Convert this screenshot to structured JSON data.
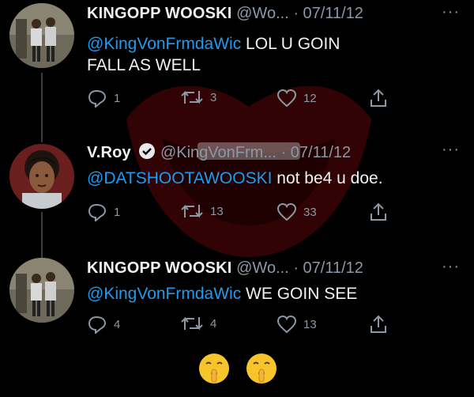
{
  "tweets": [
    {
      "name": "KINGOPP WOOSKI",
      "handle": "@Wo...",
      "separator": "·",
      "date": "07/11/12",
      "more": "···",
      "mention": "@KingVonFrmdaWic",
      "text": " LOL U GOIN FALL AS WELL",
      "replies": "1",
      "retweets": "3",
      "likes": "12"
    },
    {
      "name": "V.Roy",
      "handle": "@KingVonFrm...",
      "separator": "·",
      "date": "07/11/12",
      "more": "···",
      "mention": "@DATSHOOTAWOOSKI",
      "text": " not be4 u doe.",
      "replies": "1",
      "retweets": "13",
      "likes": "33"
    },
    {
      "name": "KINGOPP WOOSKI",
      "handle": "@Wo...",
      "separator": "·",
      "date": "07/11/12",
      "more": "···",
      "mention": "@KingVonFrmdaWic",
      "text": " WE GOIN SEE",
      "replies": "4",
      "retweets": "4",
      "likes": "13"
    }
  ],
  "emoji_row": [
    "shushing-face-emoji",
    "shushing-face-emoji"
  ],
  "colors": {
    "background": "#000000",
    "mention": "#1d9bf0",
    "muted": "#8b98a5",
    "watermark": "#c0101a"
  }
}
